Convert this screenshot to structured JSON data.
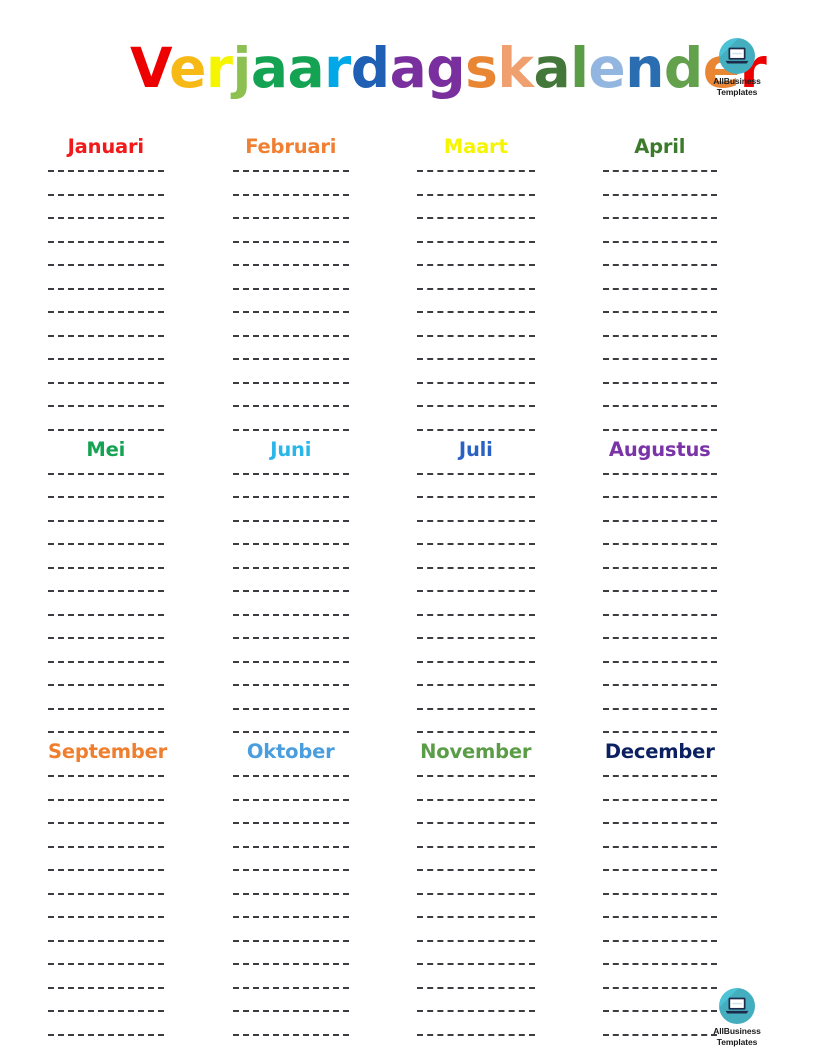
{
  "document": {
    "title": "Verjaardagskalender",
    "title_letters": [
      {
        "char": "V",
        "color": "#ec0000"
      },
      {
        "char": "e",
        "color": "#f7b916"
      },
      {
        "char": "r",
        "color": "#f5f500"
      },
      {
        "char": "j",
        "color": "#8cc152"
      },
      {
        "char": "a",
        "color": "#14a352"
      },
      {
        "char": "a",
        "color": "#14a352"
      },
      {
        "char": "r",
        "color": "#00a8e8"
      },
      {
        "char": "d",
        "color": "#1f5fb4"
      },
      {
        "char": "a",
        "color": "#7a2f9e"
      },
      {
        "char": "g",
        "color": "#7a2f9e"
      },
      {
        "char": "s",
        "color": "#e98634"
      },
      {
        "char": "k",
        "color": "#f0a06e"
      },
      {
        "char": "a",
        "color": "#44773a"
      },
      {
        "char": "l",
        "color": "#5b9c47"
      },
      {
        "char": "e",
        "color": "#92b6e0"
      },
      {
        "char": "n",
        "color": "#2a6db0"
      },
      {
        "char": "d",
        "color": "#63a14d"
      },
      {
        "char": "e",
        "color": "#e98634"
      },
      {
        "char": "r",
        "color": "#ec0000"
      }
    ]
  },
  "logo": {
    "name": "AllBusiness Templates",
    "line1": "AllBusiness",
    "line2": "Templates",
    "circle_color": "#4cc2d4",
    "laptop_color": "#1c2b4a",
    "screen_color": "#ffffff"
  },
  "calendar": {
    "lines_per_month": 12,
    "line_color": "#3c3c41",
    "rows": [
      {
        "months": [
          {
            "name": "Januari",
            "color": "#f11919"
          },
          {
            "name": "Februari",
            "color": "#ef8033"
          },
          {
            "name": "Maart",
            "color": "#f5f500"
          },
          {
            "name": "April",
            "color": "#3c7a2c"
          }
        ]
      },
      {
        "months": [
          {
            "name": "Mei",
            "color": "#14a352"
          },
          {
            "name": "Juni",
            "color": "#29b6e8"
          },
          {
            "name": "Juli",
            "color": "#2a62c4"
          },
          {
            "name": "Augustus",
            "color": "#7b33a8"
          }
        ]
      },
      {
        "months": [
          {
            "name": "September",
            "color": "#ef7f2f"
          },
          {
            "name": "Oktober",
            "color": "#4a9ede"
          },
          {
            "name": "November",
            "color": "#5b9c47"
          },
          {
            "name": "December",
            "color": "#0b2060"
          }
        ]
      }
    ]
  }
}
